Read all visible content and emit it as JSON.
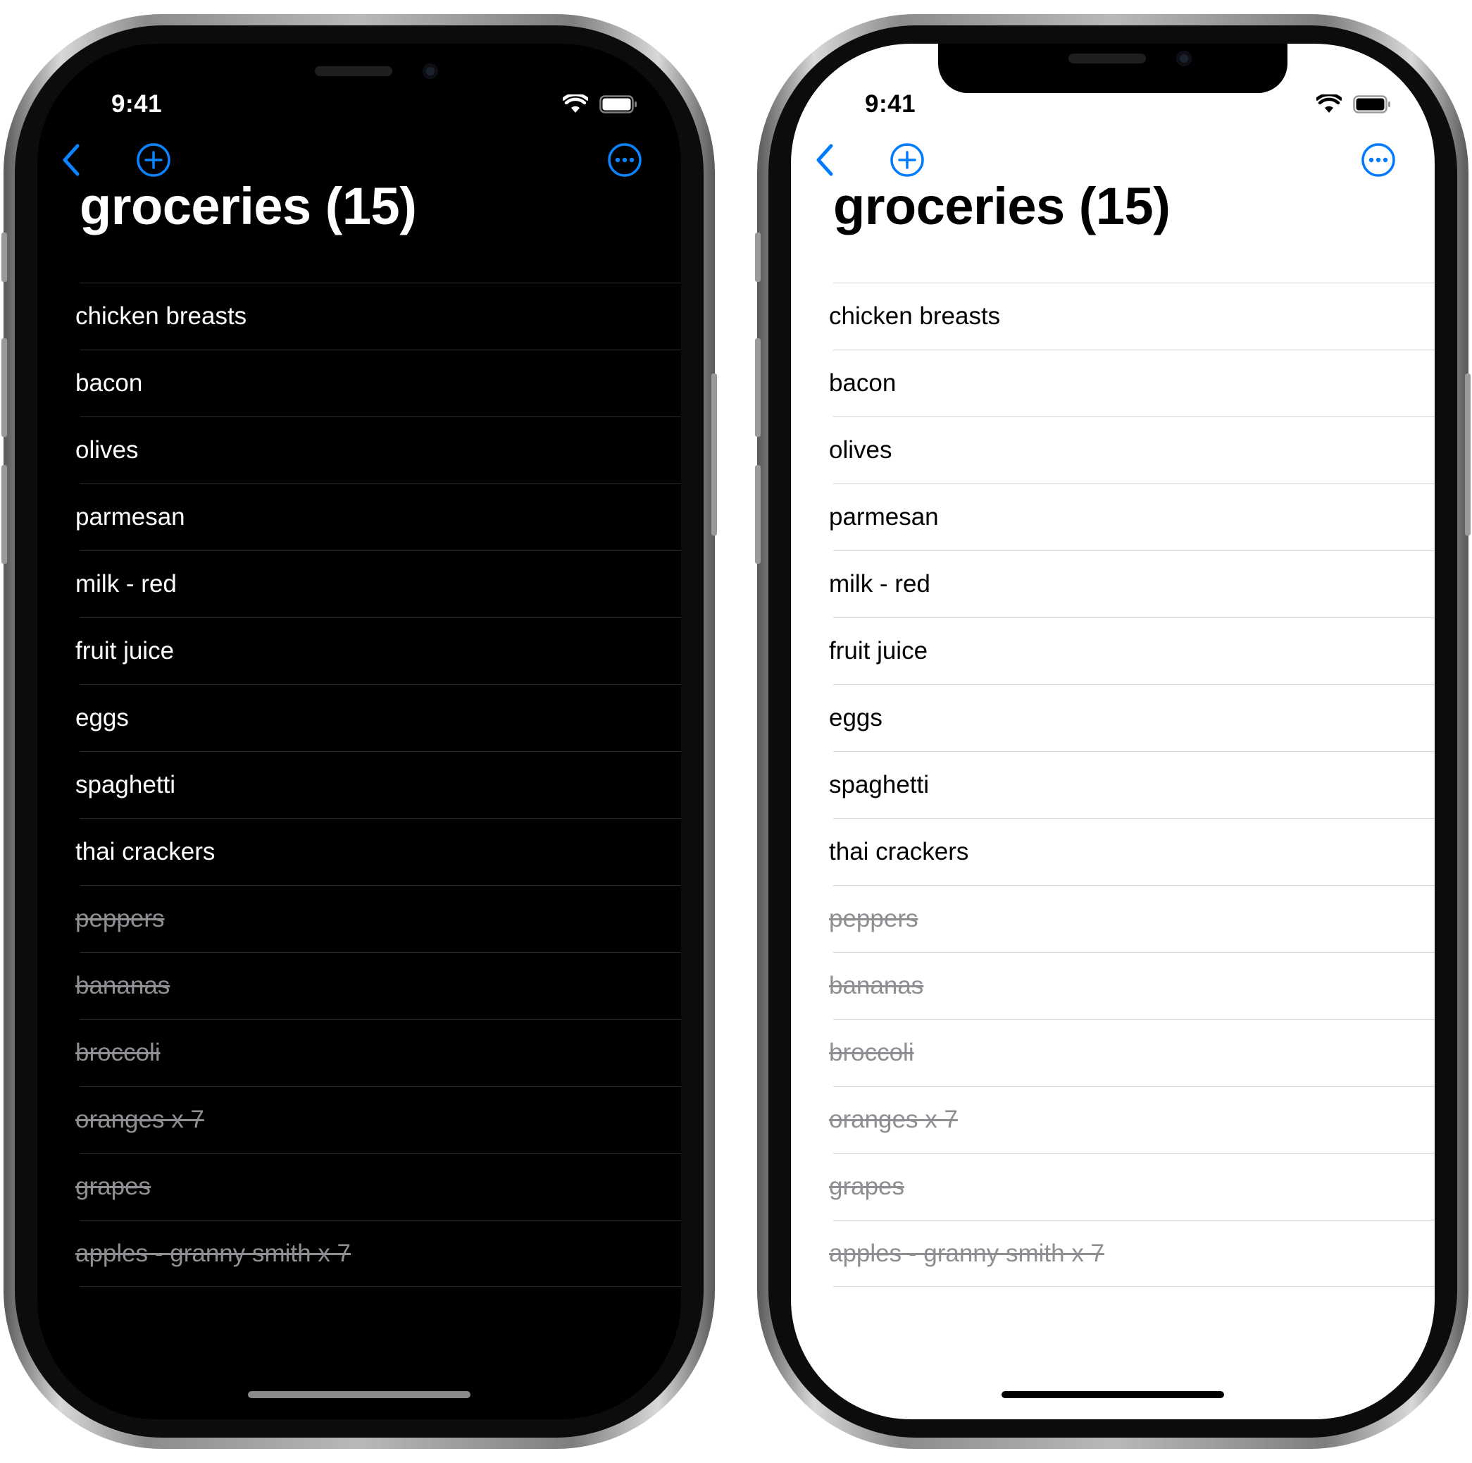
{
  "status_bar": {
    "time": "9:41"
  },
  "nav": {
    "back_icon": "chevron-left-icon",
    "add_icon": "plus-circle-icon",
    "more_icon": "ellipsis-circle-icon",
    "accent_color": "#0a84ff",
    "accent_color_light": "#007aff"
  },
  "list": {
    "title": "groceries (15)",
    "items": [
      {
        "label": "chicken breasts",
        "done": false
      },
      {
        "label": "bacon",
        "done": false
      },
      {
        "label": "olives",
        "done": false
      },
      {
        "label": "parmesan",
        "done": false
      },
      {
        "label": "milk - red",
        "done": false
      },
      {
        "label": "fruit juice",
        "done": false
      },
      {
        "label": "eggs",
        "done": false
      },
      {
        "label": "spaghetti",
        "done": false
      },
      {
        "label": "thai crackers",
        "done": false
      },
      {
        "label": "peppers",
        "done": true
      },
      {
        "label": "bananas",
        "done": true
      },
      {
        "label": "broccoli",
        "done": true
      },
      {
        "label": "oranges x 7",
        "done": true
      },
      {
        "label": "grapes",
        "done": true
      },
      {
        "label": "apples - granny smith x 7",
        "done": true
      }
    ]
  },
  "themes": {
    "dark": {
      "background": "#000000",
      "text": "#ffffff"
    },
    "light": {
      "background": "#ffffff",
      "text": "#000000"
    },
    "done_text": "#8e8e93"
  }
}
